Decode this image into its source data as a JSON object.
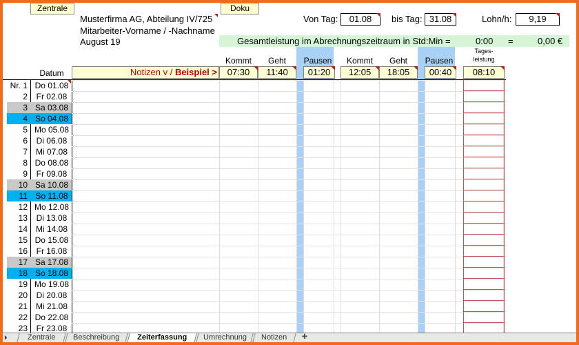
{
  "toolbar": {
    "zentrale_label": "Zentrale",
    "doku_label": "Doku"
  },
  "company": {
    "name": "Musterfirma AG, Abteilung IV/725",
    "employee": "Mitarbeiter-Vorname / -Nachname",
    "period": "August 19"
  },
  "filter": {
    "from_label": "Von Tag:",
    "from_value": "01.08",
    "to_label": "bis Tag:",
    "to_value": "31.08",
    "rate_label": "Lohn/h:",
    "rate_value": "9,19"
  },
  "total": {
    "label": "Gesamtleistung im Abrechnungszeitraum in Std:Min =",
    "time": "0:00",
    "eq": "=",
    "amount": "0,00 €"
  },
  "columns": {
    "datum": "Datum",
    "kommt1": "Kommt",
    "geht1": "Geht",
    "pausen1": "Pausen",
    "kommt2": "Kommt",
    "geht2": "Geht",
    "pausen2": "Pausen",
    "tages1": "Tages-",
    "tages2": "leistung"
  },
  "example": {
    "label_prefix": "Notizen v / ",
    "label_bold": "Beispiel >",
    "kommt1": "07:30",
    "geht1": "11:40",
    "pausen1": "01:20",
    "kommt2": "12:05",
    "geht2": "18:05",
    "pausen2": "00:40",
    "tages": "08:10"
  },
  "rows": [
    {
      "num": "Nr. 1",
      "date": "Do 01.08",
      "type": "weekday"
    },
    {
      "num": "2",
      "date": "Fr 02.08",
      "type": "weekday"
    },
    {
      "num": "3",
      "date": "Sa 03.08",
      "type": "saturday"
    },
    {
      "num": "4",
      "date": "So 04.08",
      "type": "sunday"
    },
    {
      "num": "5",
      "date": "Mo 05.08",
      "type": "weekday"
    },
    {
      "num": "6",
      "date": "Di 06.08",
      "type": "weekday"
    },
    {
      "num": "7",
      "date": "Mi 07.08",
      "type": "weekday"
    },
    {
      "num": "8",
      "date": "Do 08.08",
      "type": "weekday"
    },
    {
      "num": "9",
      "date": "Fr 09.08",
      "type": "weekday"
    },
    {
      "num": "10",
      "date": "Sa 10.08",
      "type": "saturday"
    },
    {
      "num": "11",
      "date": "So 11.08",
      "type": "sunday"
    },
    {
      "num": "12",
      "date": "Mo 12.08",
      "type": "weekday"
    },
    {
      "num": "13",
      "date": "Di 13.08",
      "type": "weekday"
    },
    {
      "num": "14",
      "date": "Mi 14.08",
      "type": "weekday"
    },
    {
      "num": "15",
      "date": "Do 15.08",
      "type": "weekday"
    },
    {
      "num": "16",
      "date": "Fr 16.08",
      "type": "weekday"
    },
    {
      "num": "17",
      "date": "Sa 17.08",
      "type": "saturday"
    },
    {
      "num": "18",
      "date": "So 18.08",
      "type": "sunday"
    },
    {
      "num": "19",
      "date": "Mo 19.08",
      "type": "weekday"
    },
    {
      "num": "20",
      "date": "Di 20.08",
      "type": "weekday"
    },
    {
      "num": "21",
      "date": "Mi 21.08",
      "type": "weekday"
    },
    {
      "num": "22",
      "date": "Do 22.08",
      "type": "weekday"
    },
    {
      "num": "23",
      "date": "Fr 23.08",
      "type": "weekday"
    }
  ],
  "colors": {
    "saturday": "#c8c8c8",
    "sunday": "#00b0f0",
    "pause_band": "#a9d1f5",
    "total_band": "#d6f5d6",
    "accent_red": "#c00000"
  },
  "tabs": [
    {
      "label": "Zentrale"
    },
    {
      "label": "Beschreibung"
    },
    {
      "label": "Zeiterfassung",
      "active": true
    },
    {
      "label": "Umrechnung"
    },
    {
      "label": "Notizen"
    }
  ]
}
